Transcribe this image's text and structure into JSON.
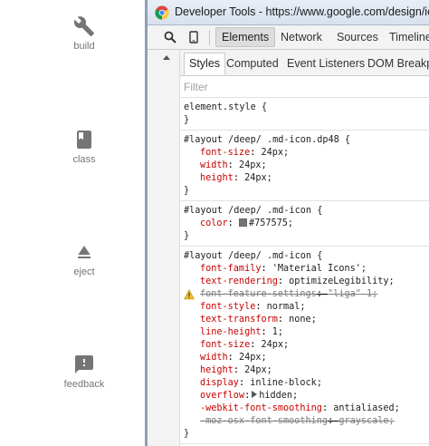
{
  "gallery": {
    "tiles": [
      {
        "label": "build",
        "icon": "wrench-icon"
      },
      {
        "label": "class",
        "icon": "bookmark-book-icon"
      },
      {
        "label": "eject",
        "icon": "eject-icon"
      },
      {
        "label": "feedback",
        "icon": "feedback-bubble-icon"
      }
    ],
    "icon_color": "#757575"
  },
  "devtools": {
    "window_title": "Developer Tools - https://www.google.com/design/ic",
    "toolbar": {
      "tabs": [
        "Elements",
        "Network",
        "Sources",
        "Timeline"
      ],
      "active_tab": "Elements"
    },
    "styles_subtabs": [
      "Styles",
      "Computed",
      "Event Listeners",
      "DOM Breakpo"
    ],
    "filter_placeholder": "Filter",
    "rules": [
      {
        "selector": "element.style {",
        "close": "}"
      },
      {
        "selector": "#layout /deep/ .md-icon.dp48 {",
        "close": "}",
        "props": [
          {
            "name": "font-size",
            "value": "24px;"
          },
          {
            "name": "width",
            "value": "24px;"
          },
          {
            "name": "height",
            "value": "24px;"
          }
        ]
      },
      {
        "selector": "#layout /deep/ .md-icon {",
        "close": "}",
        "props": [
          {
            "name": "color",
            "value": "#757575;",
            "swatch": "#757575"
          }
        ]
      },
      {
        "selector": "#layout /deep/ .md-icon {",
        "close": "}",
        "props": [
          {
            "name": "font-family",
            "value": "'Material Icons';"
          },
          {
            "name": "text-rendering",
            "value": "optimizeLegibility;"
          },
          {
            "name": "font-feature-settings",
            "value": "\"liga\" 1;",
            "struck": true,
            "warning": true
          },
          {
            "name": "font-style",
            "value": "normal;"
          },
          {
            "name": "text-transform",
            "value": "none;"
          },
          {
            "name": "line-height",
            "value": "1;"
          },
          {
            "name": "font-size",
            "value": "24px;"
          },
          {
            "name": "width",
            "value": "24px;"
          },
          {
            "name": "height",
            "value": "24px;"
          },
          {
            "name": "display",
            "value": "inline-block;"
          },
          {
            "name": "overflow",
            "value": "hidden;",
            "expander": true
          },
          {
            "name": "-webkit-font-smoothing",
            "value": "antialiased;"
          },
          {
            "name": "-moz-osx-font-smoothing",
            "value": "grayscale;",
            "struck": true
          }
        ]
      }
    ]
  }
}
